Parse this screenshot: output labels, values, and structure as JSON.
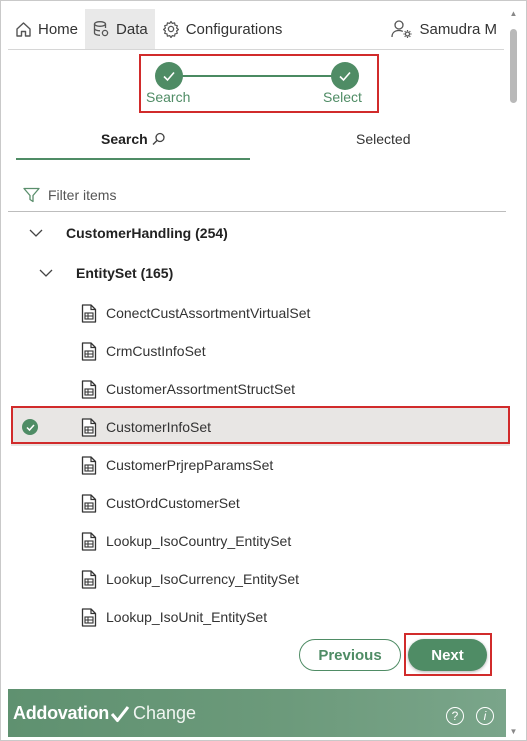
{
  "nav": {
    "home": "Home",
    "data": "Data",
    "configurations": "Configurations",
    "user": "Samudra M"
  },
  "stepper": {
    "step1": "Search",
    "step2": "Select"
  },
  "tabs": {
    "search": "Search",
    "selected": "Selected"
  },
  "filter": {
    "label": "Filter items"
  },
  "tree": {
    "group": "CustomerHandling (254)",
    "subgroup": "EntitySet (165)",
    "items": [
      {
        "label": "ConectCustAssortmentVirtualSet",
        "selected": false
      },
      {
        "label": "CrmCustInfoSet",
        "selected": false
      },
      {
        "label": "CustomerAssortmentStructSet",
        "selected": false
      },
      {
        "label": "CustomerInfoSet",
        "selected": true
      },
      {
        "label": "CustomerPrjrepParamsSet",
        "selected": false
      },
      {
        "label": "CustOrdCustomerSet",
        "selected": false
      },
      {
        "label": "Lookup_IsoCountry_EntitySet",
        "selected": false
      },
      {
        "label": "Lookup_IsoCurrency_EntitySet",
        "selected": false
      },
      {
        "label": "Lookup_IsoUnit_EntitySet",
        "selected": false
      }
    ]
  },
  "buttons": {
    "previous": "Previous",
    "next": "Next"
  },
  "footer": {
    "brand_bold": "Addovation",
    "brand_light": "Change"
  },
  "colors": {
    "accent": "#4f8c65",
    "highlight": "#d12b2b"
  }
}
